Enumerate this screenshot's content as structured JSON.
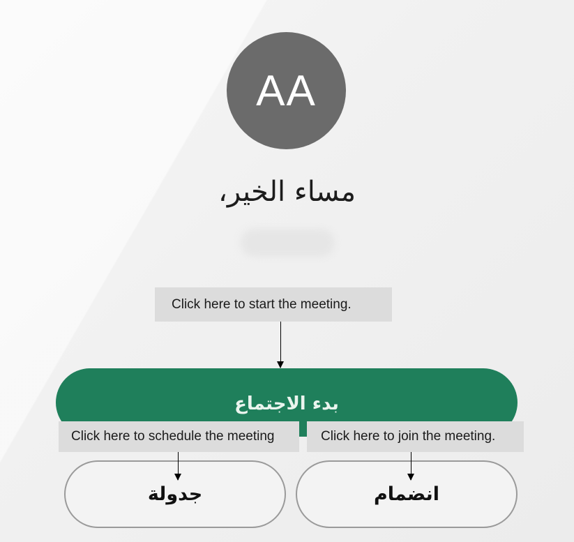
{
  "profile": {
    "avatar_initials": "AA",
    "greeting": "مساء الخير،"
  },
  "actions": {
    "start_label": "بدء الاجتماع",
    "schedule_label": "جدولة",
    "join_label": "انضمام"
  },
  "callouts": {
    "start": "Click here to start the meeting.",
    "schedule": "Click here to schedule the meeting",
    "join": "Click here to join the meeting."
  },
  "colors": {
    "start_button": "#1f7f5b",
    "avatar": "#6b6b6b",
    "callout_bg": "#dcdcdc"
  }
}
